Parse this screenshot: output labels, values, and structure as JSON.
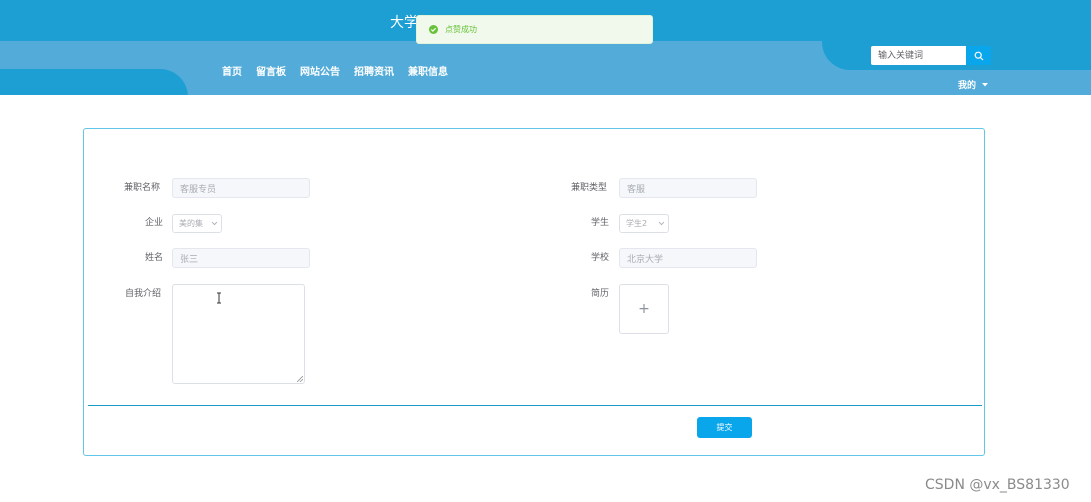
{
  "header": {
    "site_title": "大学",
    "nav": [
      "首页",
      "留言板",
      "网站公告",
      "招聘资讯",
      "兼职信息"
    ],
    "search_placeholder": "输入关键词",
    "mine_label": "我的"
  },
  "toast": {
    "message": "点赞成功"
  },
  "form": {
    "job_name": {
      "label": "兼职名称",
      "value": "客服专员"
    },
    "job_type": {
      "label": "兼职类型",
      "value": "客服"
    },
    "company": {
      "label": "企业",
      "value": "美的集"
    },
    "student": {
      "label": "学生",
      "value": "学生2"
    },
    "name": {
      "label": "姓名",
      "value": "张三"
    },
    "school": {
      "label": "学校",
      "value": "北京大学"
    },
    "intro": {
      "label": "自我介绍"
    },
    "resume": {
      "label": "简历",
      "upload_symbol": "+"
    },
    "submit_label": "提交"
  },
  "colors": {
    "primary": "#0aa6ec",
    "header": "#1e9fd3",
    "success": "#67c23a"
  },
  "watermark": "CSDN @vx_BS81330"
}
